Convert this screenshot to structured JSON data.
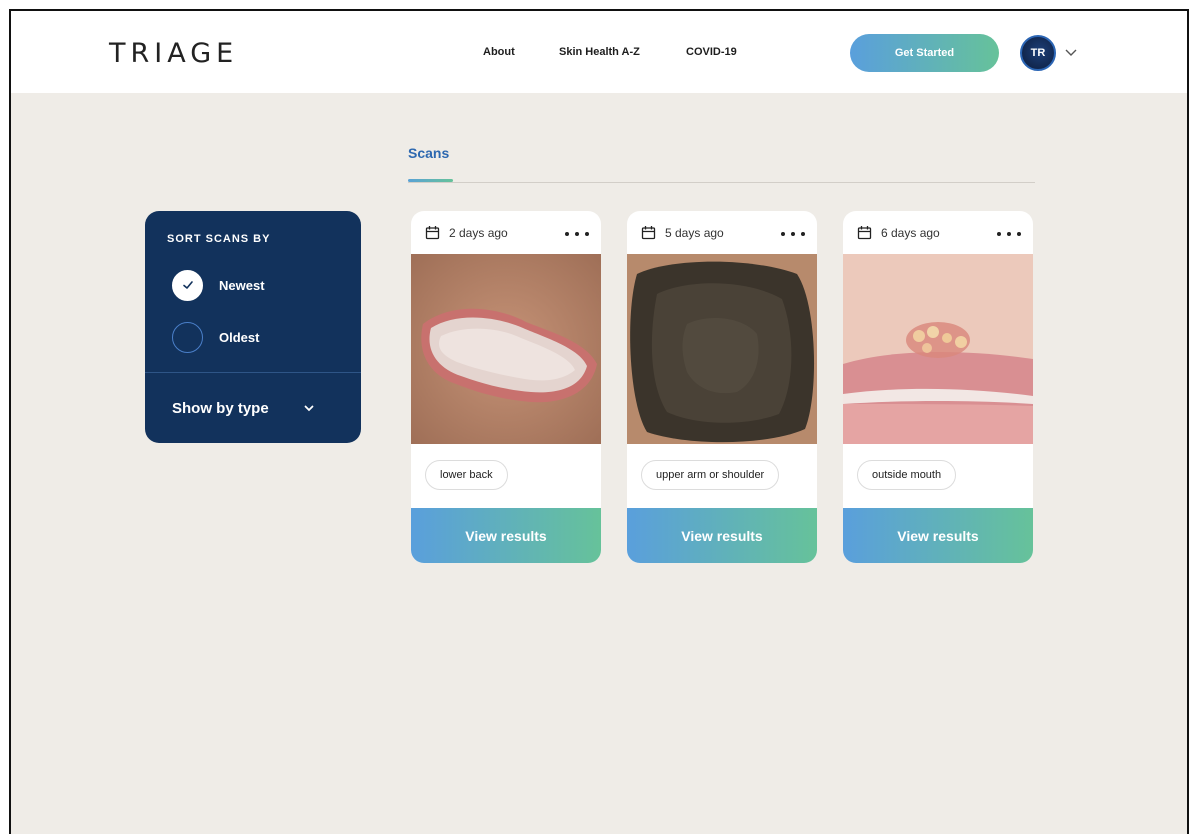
{
  "header": {
    "logo": "TRIAGE",
    "nav": [
      {
        "label": "About"
      },
      {
        "label": "Skin Health A-Z"
      },
      {
        "label": "COVID-19"
      }
    ],
    "cta_label": "Get Started",
    "avatar_initials": "TR"
  },
  "tabs": {
    "active_label": "Scans"
  },
  "sort_panel": {
    "title": "SORT SCANS BY",
    "options": [
      {
        "label": "Newest",
        "selected": true
      },
      {
        "label": "Oldest",
        "selected": false
      }
    ],
    "filter_label": "Show by type"
  },
  "scans": [
    {
      "date": "2 days ago",
      "location": "lower back",
      "button_label": "View results",
      "image": "skin-lesion-photo"
    },
    {
      "date": "5 days ago",
      "location": "upper arm or shoulder",
      "button_label": "View results",
      "image": "skin-lesion-photo"
    },
    {
      "date": "6 days ago",
      "location": "outside mouth",
      "button_label": "View results",
      "image": "skin-lesion-photo"
    }
  ],
  "colors": {
    "background": "#efece7",
    "panel": "#12325c",
    "accent_blue": "#5a9fdc",
    "accent_green": "#66c29a",
    "tab_active": "#2d68b0"
  },
  "icons": [
    "calendar-icon",
    "more-options-icon",
    "check-icon",
    "chevron-down-icon"
  ]
}
